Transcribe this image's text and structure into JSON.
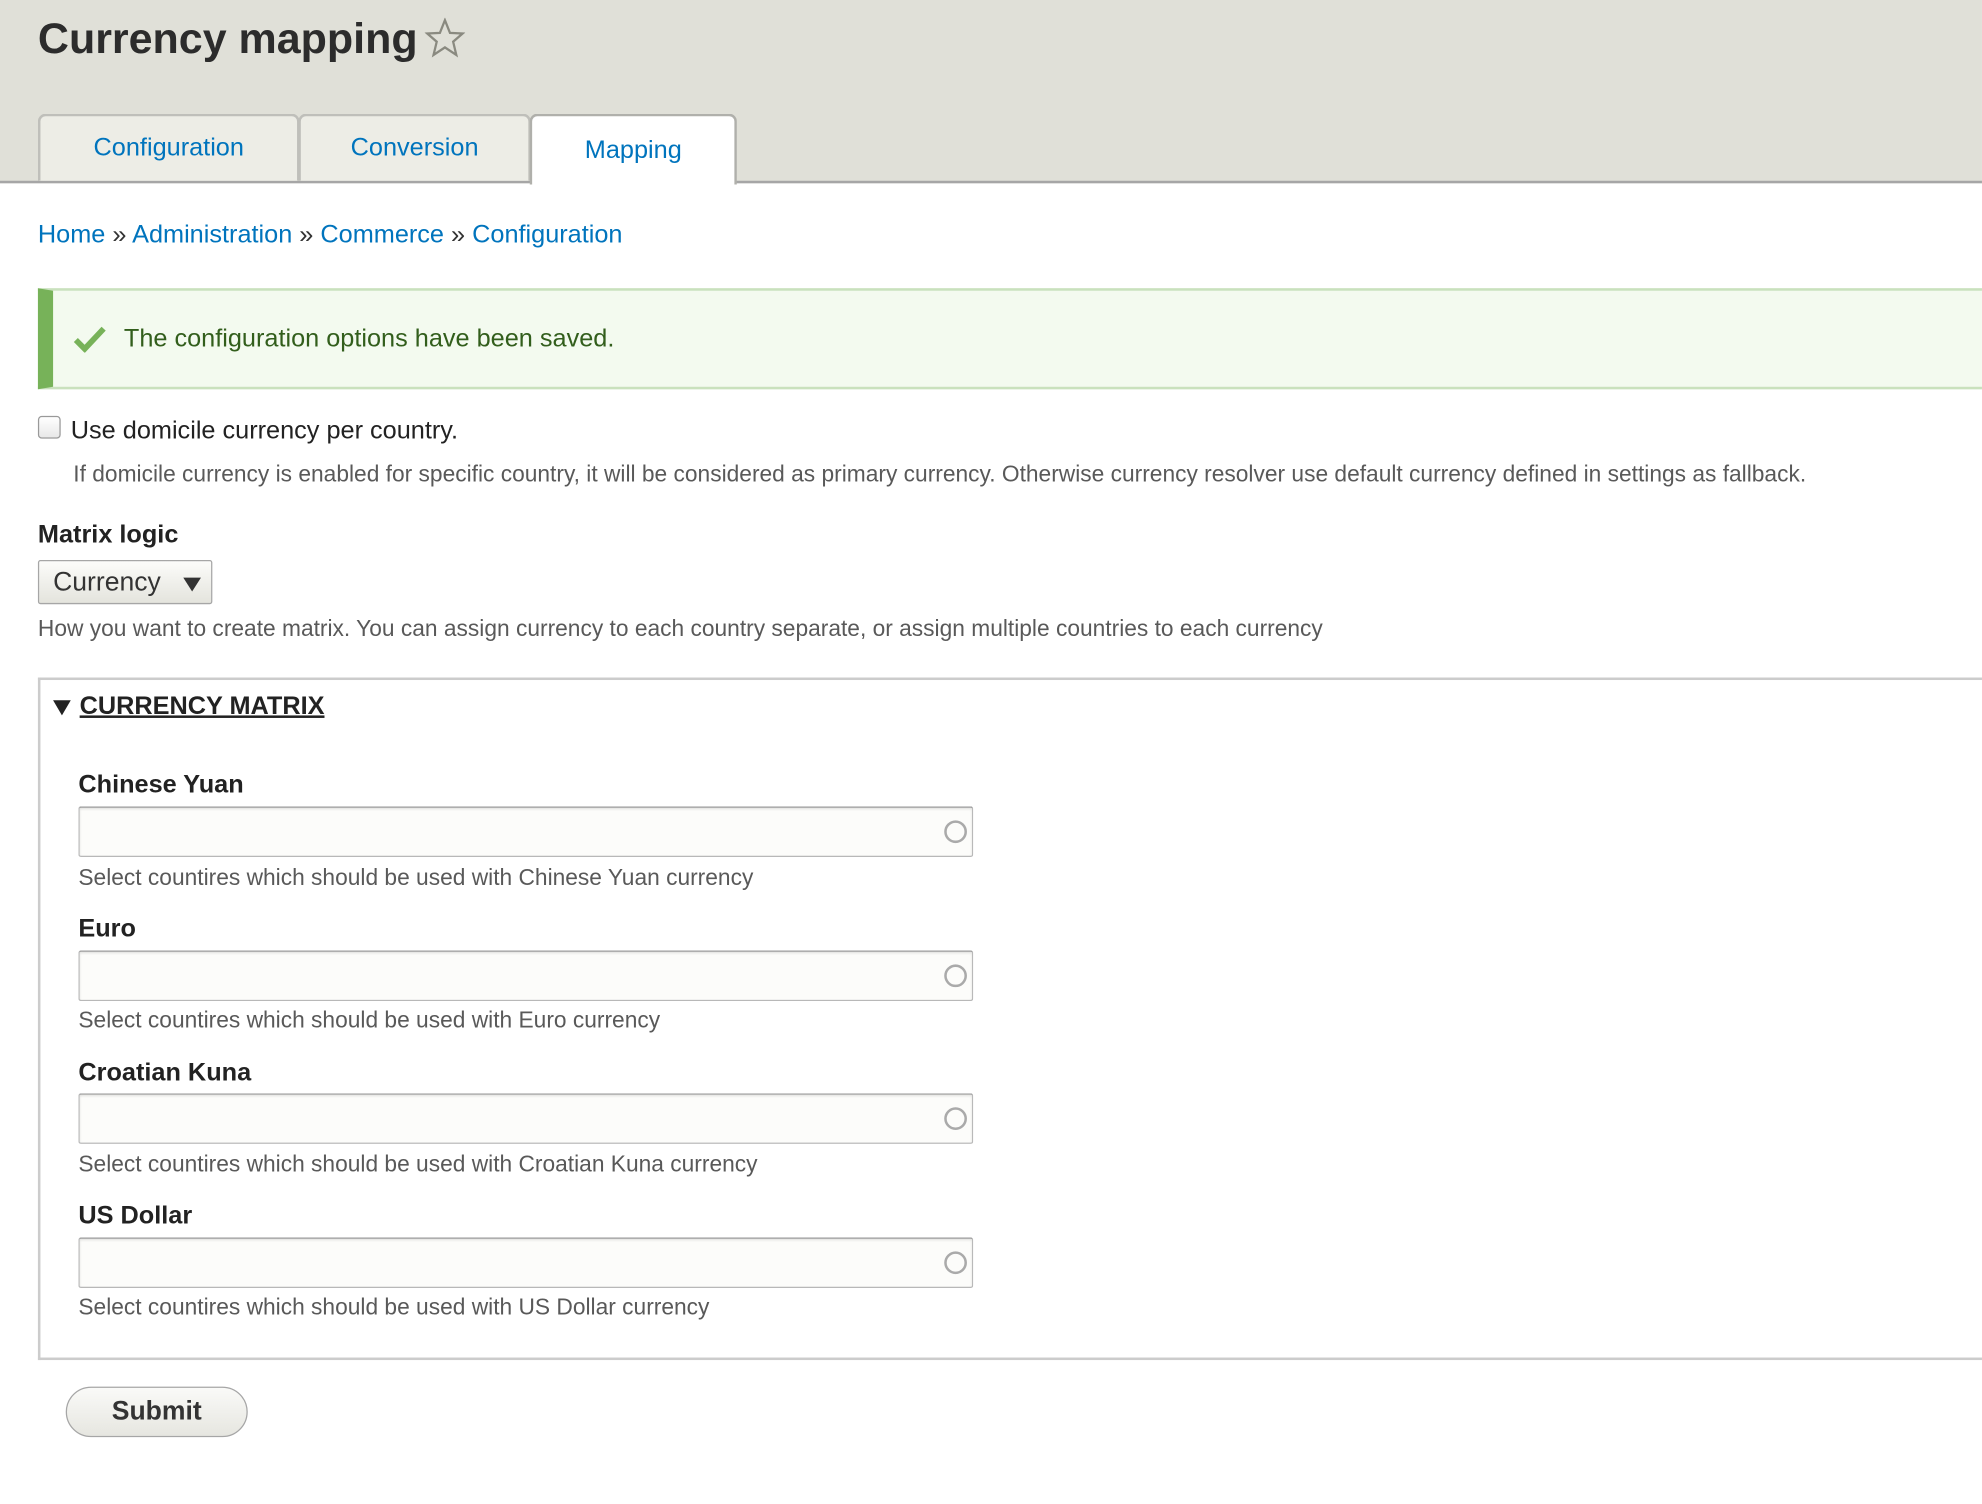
{
  "page": {
    "title": "Currency mapping",
    "star_icon": "star-outline-icon"
  },
  "tabs": [
    {
      "label": "Configuration",
      "active": false
    },
    {
      "label": "Conversion",
      "active": false
    },
    {
      "label": "Mapping",
      "active": true
    }
  ],
  "breadcrumb": {
    "items": [
      "Home",
      "Administration",
      "Commerce",
      "Configuration"
    ],
    "separator": "»"
  },
  "status_message": {
    "text": "The configuration options have been saved.",
    "icon": "checkmark-icon",
    "color": "#77b259"
  },
  "domicile": {
    "label": "Use domicile currency per country.",
    "checked": false,
    "description": "If domicile currency is enabled for specific country, it will be considered as primary currency. Otherwise currency resolver use default currency defined in settings as fallback."
  },
  "matrix_logic": {
    "label": "Matrix logic",
    "value": "Currency",
    "description": "How you want to create matrix. You can assign currency to each country separate, or assign multiple countries to each currency"
  },
  "currency_matrix": {
    "legend": "CURRENCY MATRIX",
    "fields": [
      {
        "label": "Chinese Yuan",
        "value": "",
        "description": "Select countires which should be used with Chinese Yuan currency"
      },
      {
        "label": "Euro",
        "value": "",
        "description": "Select countires which should be used with Euro currency"
      },
      {
        "label": "Croatian Kuna",
        "value": "",
        "description": "Select countires which should be used with Croatian Kuna currency"
      },
      {
        "label": "US Dollar",
        "value": "",
        "description": "Select countires which should be used with US Dollar currency"
      }
    ]
  },
  "actions": {
    "submit_label": "Submit"
  },
  "colors": {
    "link": "#0074bd",
    "header_bg": "#e0e0d8",
    "status_bg": "#f3faef"
  }
}
